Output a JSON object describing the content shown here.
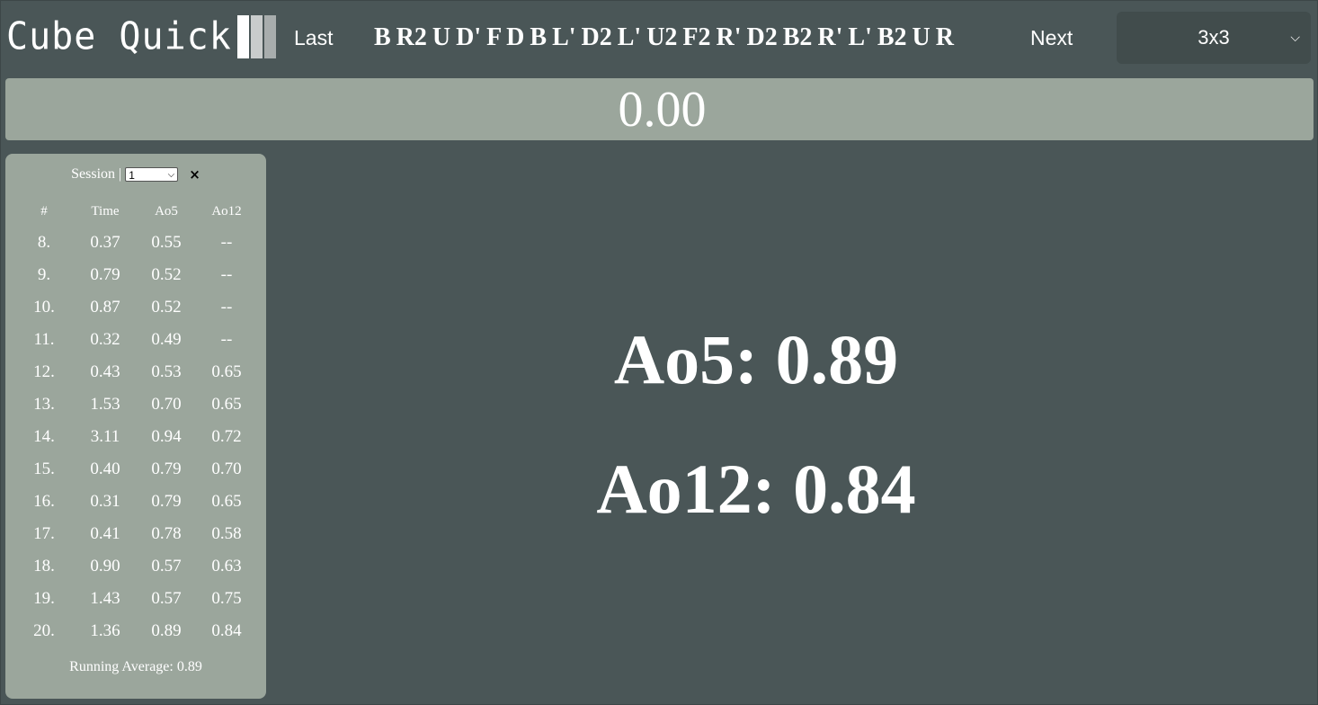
{
  "header": {
    "logo_text": "Cube Quick",
    "last_label": "Last",
    "scramble": "B R2 U D' F D B L' D2 L' U2 F2 R' D2 B2 R' L' B2 U R",
    "next_label": "Next",
    "puzzle_selected": "3x3"
  },
  "timer": {
    "value": "0.00"
  },
  "sidebar": {
    "session_label": "Session |",
    "session_selected": "1",
    "delete_icon": "×",
    "columns": [
      "#",
      "Time",
      "Ao5",
      "Ao12"
    ],
    "rows": [
      {
        "n": "8.",
        "time": "0.37",
        "ao5": "0.55",
        "ao12": "--"
      },
      {
        "n": "9.",
        "time": "0.79",
        "ao5": "0.52",
        "ao12": "--"
      },
      {
        "n": "10.",
        "time": "0.87",
        "ao5": "0.52",
        "ao12": "--"
      },
      {
        "n": "11.",
        "time": "0.32",
        "ao5": "0.49",
        "ao12": "--"
      },
      {
        "n": "12.",
        "time": "0.43",
        "ao5": "0.53",
        "ao12": "0.65"
      },
      {
        "n": "13.",
        "time": "1.53",
        "ao5": "0.70",
        "ao12": "0.65"
      },
      {
        "n": "14.",
        "time": "3.11",
        "ao5": "0.94",
        "ao12": "0.72"
      },
      {
        "n": "15.",
        "time": "0.40",
        "ao5": "0.79",
        "ao12": "0.70"
      },
      {
        "n": "16.",
        "time": "0.31",
        "ao5": "0.79",
        "ao12": "0.65"
      },
      {
        "n": "17.",
        "time": "0.41",
        "ao5": "0.78",
        "ao12": "0.58"
      },
      {
        "n": "18.",
        "time": "0.90",
        "ao5": "0.57",
        "ao12": "0.63"
      },
      {
        "n": "19.",
        "time": "1.43",
        "ao5": "0.57",
        "ao12": "0.75"
      },
      {
        "n": "20.",
        "time": "1.36",
        "ao5": "0.89",
        "ao12": "0.84"
      }
    ],
    "running_average": "Running Average: 0.89"
  },
  "stats": {
    "ao5": "Ao5: 0.89",
    "ao12": "Ao12: 0.84"
  },
  "colors": {
    "background": "#4a5657",
    "panel": "#9ba69c",
    "select_bg": "#414c4c",
    "text": "#ffffff"
  }
}
